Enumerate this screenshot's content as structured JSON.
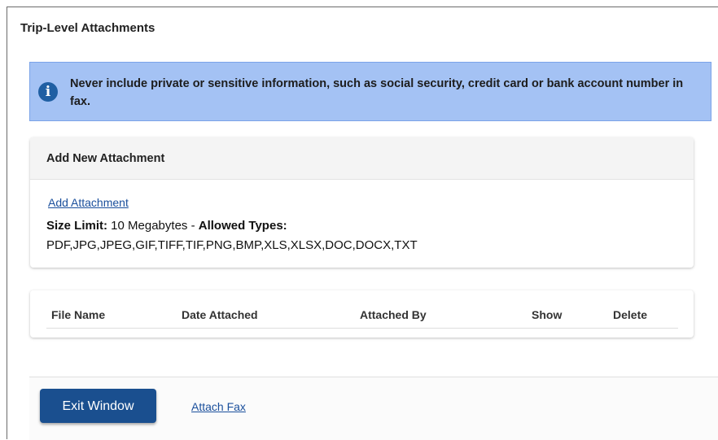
{
  "page": {
    "title": "Trip-Level Attachments"
  },
  "alert": {
    "icon": "info-icon",
    "text": "Never include private or sensitive information, such as social security, credit card or bank account number in fax."
  },
  "new_attachment": {
    "header": "Add New Attachment",
    "add_link": "Add Attachment",
    "size_limit_label": "Size Limit:",
    "size_limit_value": " 10 Megabytes - ",
    "allowed_types_label": "Allowed Types:",
    "allowed_types": "PDF,JPG,JPEG,GIF,TIFF,TIF,PNG,BMP,XLS,XLSX,DOC,DOCX,TXT"
  },
  "table": {
    "columns": [
      "File Name",
      "Date Attached",
      "Attached By",
      "Show",
      "Delete"
    ],
    "rows": []
  },
  "footer": {
    "exit_button": "Exit Window",
    "attach_fax_link": "Attach Fax"
  },
  "colors": {
    "alert_bg": "#a4c2f4",
    "primary_button": "#1a4f8f",
    "link": "#1a4f9c"
  }
}
